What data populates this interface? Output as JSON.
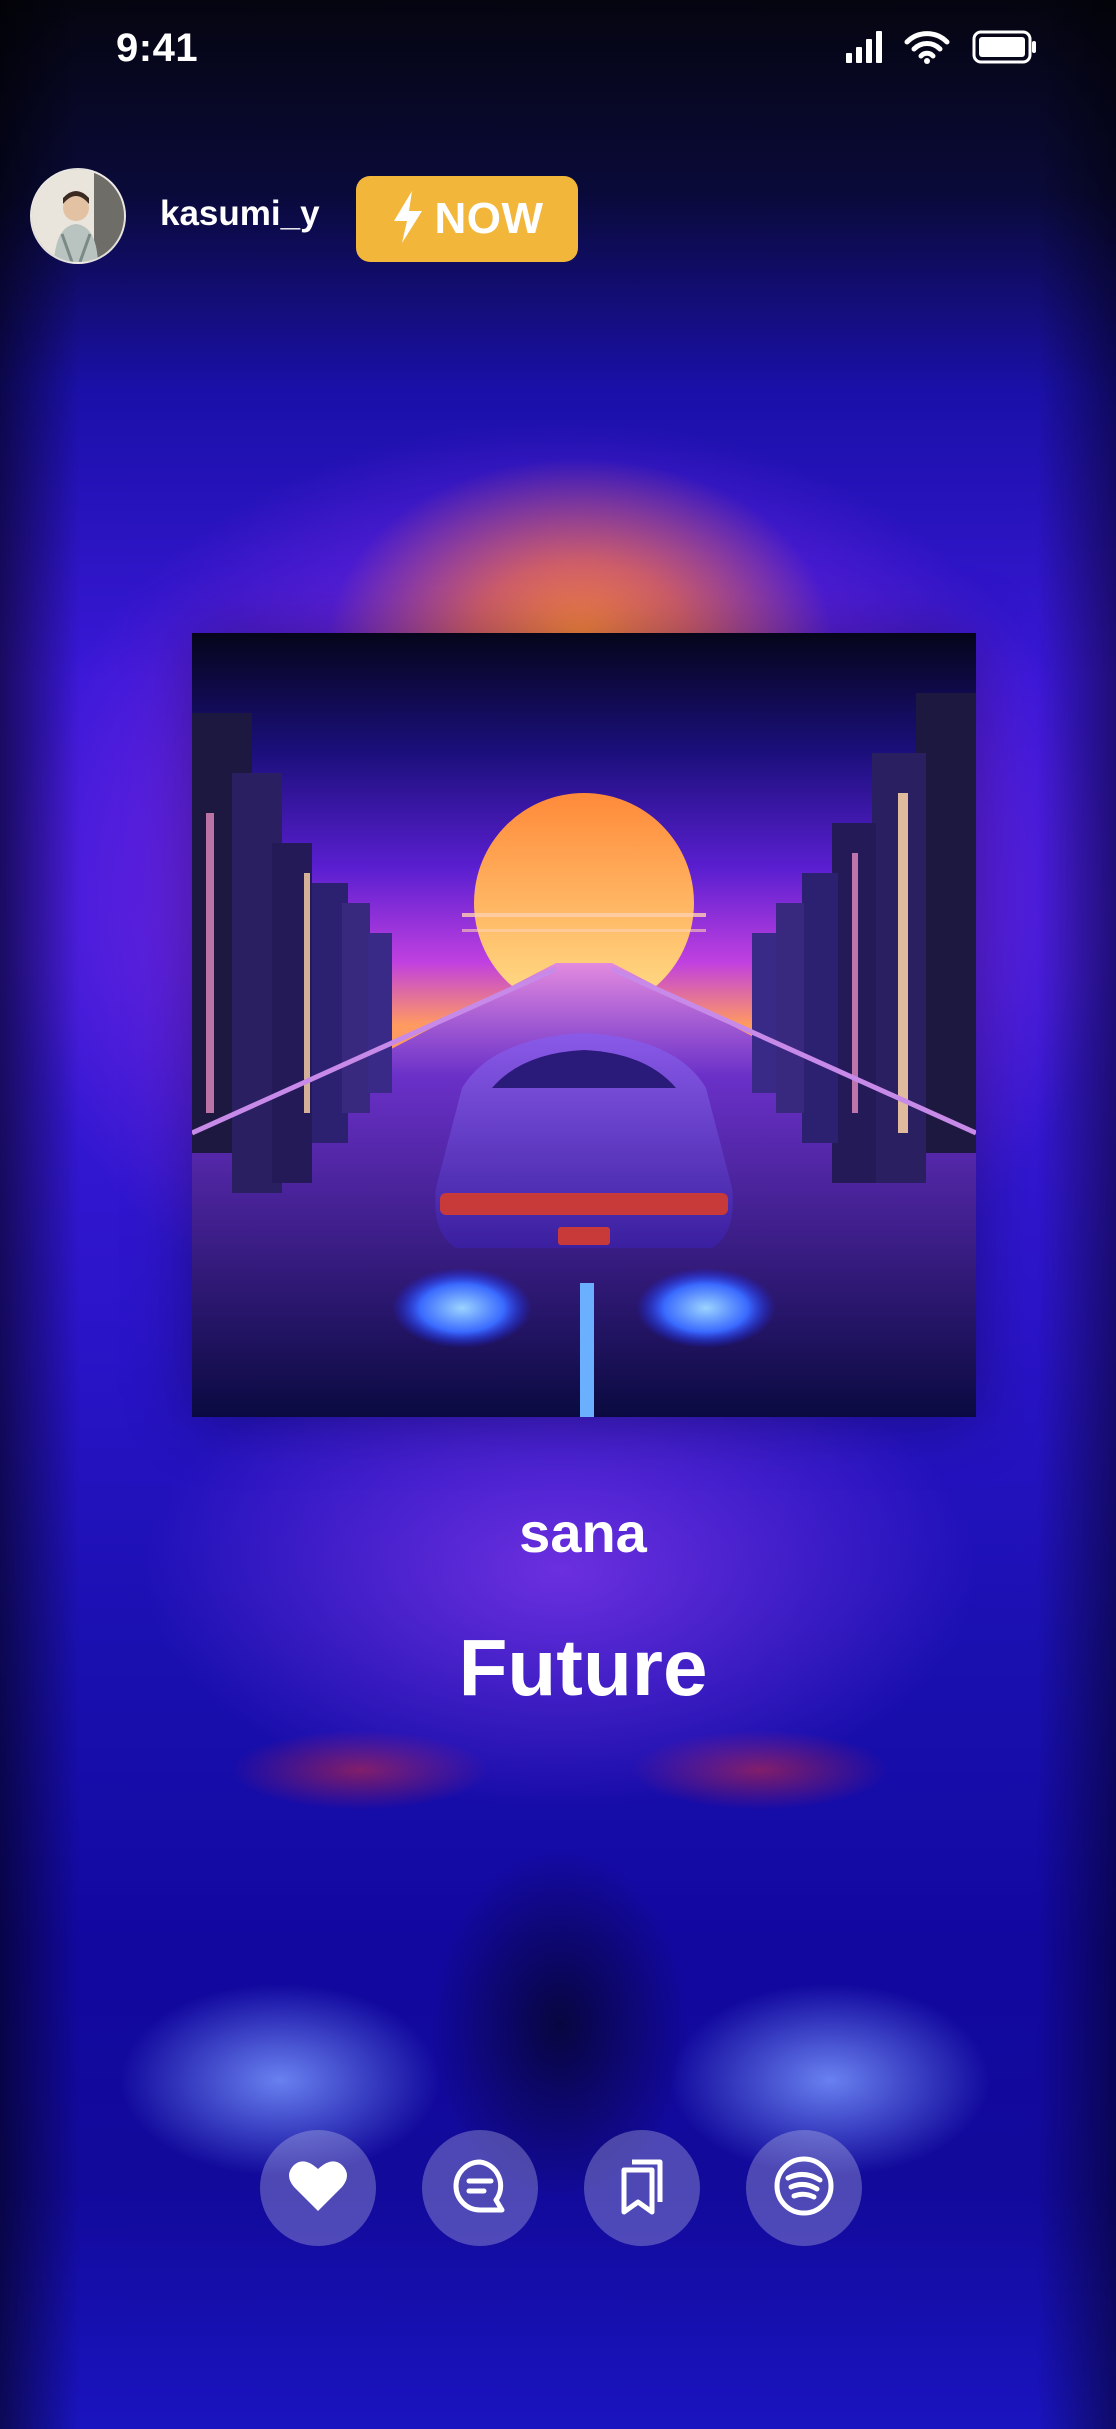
{
  "status_bar": {
    "time": "9:41",
    "icons": [
      "cellular-signal-icon",
      "wifi-icon",
      "battery-icon"
    ]
  },
  "header": {
    "username": "kasumi_y",
    "badge_label": "NOW",
    "badge_color": "#f2b63b"
  },
  "track": {
    "artist": "sana",
    "title": "Future"
  },
  "actions": [
    {
      "name": "like-button",
      "icon": "heart-icon"
    },
    {
      "name": "comment-button",
      "icon": "comment-icon"
    },
    {
      "name": "bookmark-button",
      "icon": "bookmark-icon"
    },
    {
      "name": "spotify-button",
      "icon": "spotify-icon"
    }
  ],
  "colors": {
    "accent": "#f2b63b",
    "background_top": "#050510",
    "background_mid": "#3a18d8"
  }
}
